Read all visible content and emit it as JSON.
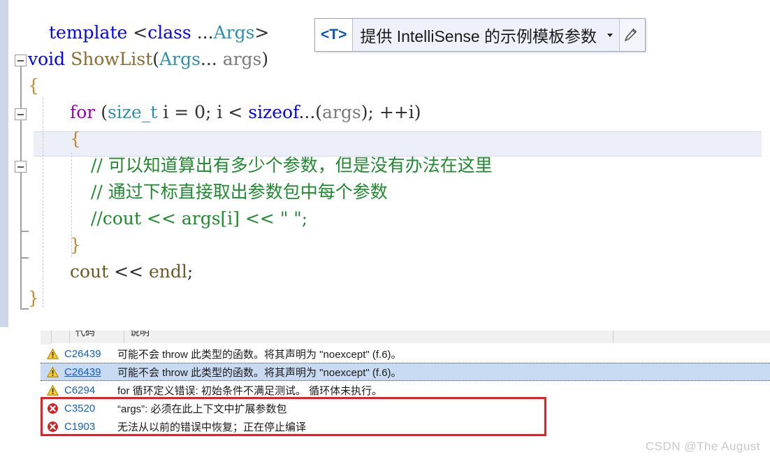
{
  "editor": {
    "language": "cpp",
    "lines": [
      {
        "indent": 1,
        "tokens": [
          {
            "t": "template ",
            "c": "kw"
          },
          {
            "t": "<",
            "c": "punct"
          },
          {
            "t": "class",
            "c": "kw"
          },
          {
            "t": " ...",
            "c": "punct"
          },
          {
            "t": "Args",
            "c": "type"
          },
          {
            "t": ">",
            "c": "punct"
          }
        ]
      },
      {
        "indent": 0,
        "tokens": [
          {
            "t": "void",
            "c": "kw"
          },
          {
            "t": " ",
            "c": "punct"
          },
          {
            "t": "ShowList",
            "c": "fn"
          },
          {
            "t": "(",
            "c": "punct"
          },
          {
            "t": "Args",
            "c": "type"
          },
          {
            "t": "... ",
            "c": "punct"
          },
          {
            "t": "args",
            "c": "ident"
          },
          {
            "t": ")",
            "c": "punct"
          }
        ]
      },
      {
        "indent": 0,
        "tokens": [
          {
            "t": "{",
            "c": "brace"
          }
        ]
      },
      {
        "indent": 2,
        "tokens": [
          {
            "t": "for",
            "c": "ctrl"
          },
          {
            "t": " (",
            "c": "punct"
          },
          {
            "t": "size_t",
            "c": "type"
          },
          {
            "t": " i = ",
            "c": "punct"
          },
          {
            "t": "0",
            "c": "num"
          },
          {
            "t": "; i < ",
            "c": "punct"
          },
          {
            "t": "sizeof",
            "c": "kw"
          },
          {
            "t": "...(",
            "c": "punct"
          },
          {
            "t": "args",
            "c": "ident"
          },
          {
            "t": "); ++i)",
            "c": "punct"
          }
        ]
      },
      {
        "indent": 2,
        "tokens": [
          {
            "t": "{",
            "c": "brace"
          }
        ]
      },
      {
        "indent": 3,
        "tokens": [
          {
            "t": "// 可以知道算出有多少个参数，但是没有办法在这里",
            "c": "comment"
          }
        ]
      },
      {
        "indent": 3,
        "tokens": [
          {
            "t": "// 通过下标直接取出参数包中每个参数",
            "c": "comment"
          }
        ]
      },
      {
        "indent": 3,
        "tokens": [
          {
            "t": "//cout << args[i] << \" \";",
            "c": "comment"
          }
        ]
      },
      {
        "indent": 2,
        "tokens": [
          {
            "t": "}",
            "c": "brace"
          }
        ]
      },
      {
        "indent": 2,
        "tokens": [
          {
            "t": "cout",
            "c": "std"
          },
          {
            "t": " << ",
            "c": "punct"
          },
          {
            "t": "endl",
            "c": "std"
          },
          {
            "t": ";",
            "c": "punct"
          }
        ]
      },
      {
        "indent": 0,
        "tokens": [
          {
            "t": "}",
            "c": "brace"
          }
        ]
      }
    ]
  },
  "tooltip": {
    "template_param": "<T>",
    "description": "提供 IntelliSense 的示例模板参数",
    "dropdown_icon": "chevron-down-icon",
    "edit_icon": "pencil-icon"
  },
  "error_list": {
    "columns": [
      "",
      "",
      "代码",
      "说明"
    ],
    "rows": [
      {
        "severity": "warning",
        "code": "C26439",
        "description": "可能不会 throw 此类型的函数。将其声明为 \"noexcept\" (f.6)。",
        "selected": false,
        "highlighted": false
      },
      {
        "severity": "warning",
        "code": "C26439",
        "description": "可能不会 throw 此类型的函数。将其声明为 \"noexcept\" (f.6)。",
        "selected": true,
        "highlighted": false
      },
      {
        "severity": "warning",
        "code": "C6294",
        "description": "for 循环定义错误: 初始条件不满足测试。 循环体未执行。",
        "selected": false,
        "highlighted": false
      },
      {
        "severity": "error",
        "code": "C3520",
        "description": "“args”: 必须在此上下文中扩展参数包",
        "selected": false,
        "highlighted": true
      },
      {
        "severity": "error",
        "code": "C1903",
        "description": "无法从以前的错误中恢复；正在停止编译",
        "selected": false,
        "highlighted": true
      }
    ],
    "annotation_color": "#ee1c22"
  },
  "watermark": "CSDN @The  August",
  "colors": {
    "keyword": "#0000ff",
    "control_keyword": "#9b00b4",
    "type": "#2b91af",
    "function": "#8b6b2e",
    "identifier": "#7a7a7a",
    "comment": "#1f8b2f",
    "error_code_link": "#1060c0",
    "selection_margin": "#ccd6e8",
    "current_line": "#eceef8",
    "selected_row": "#c9daf3"
  }
}
